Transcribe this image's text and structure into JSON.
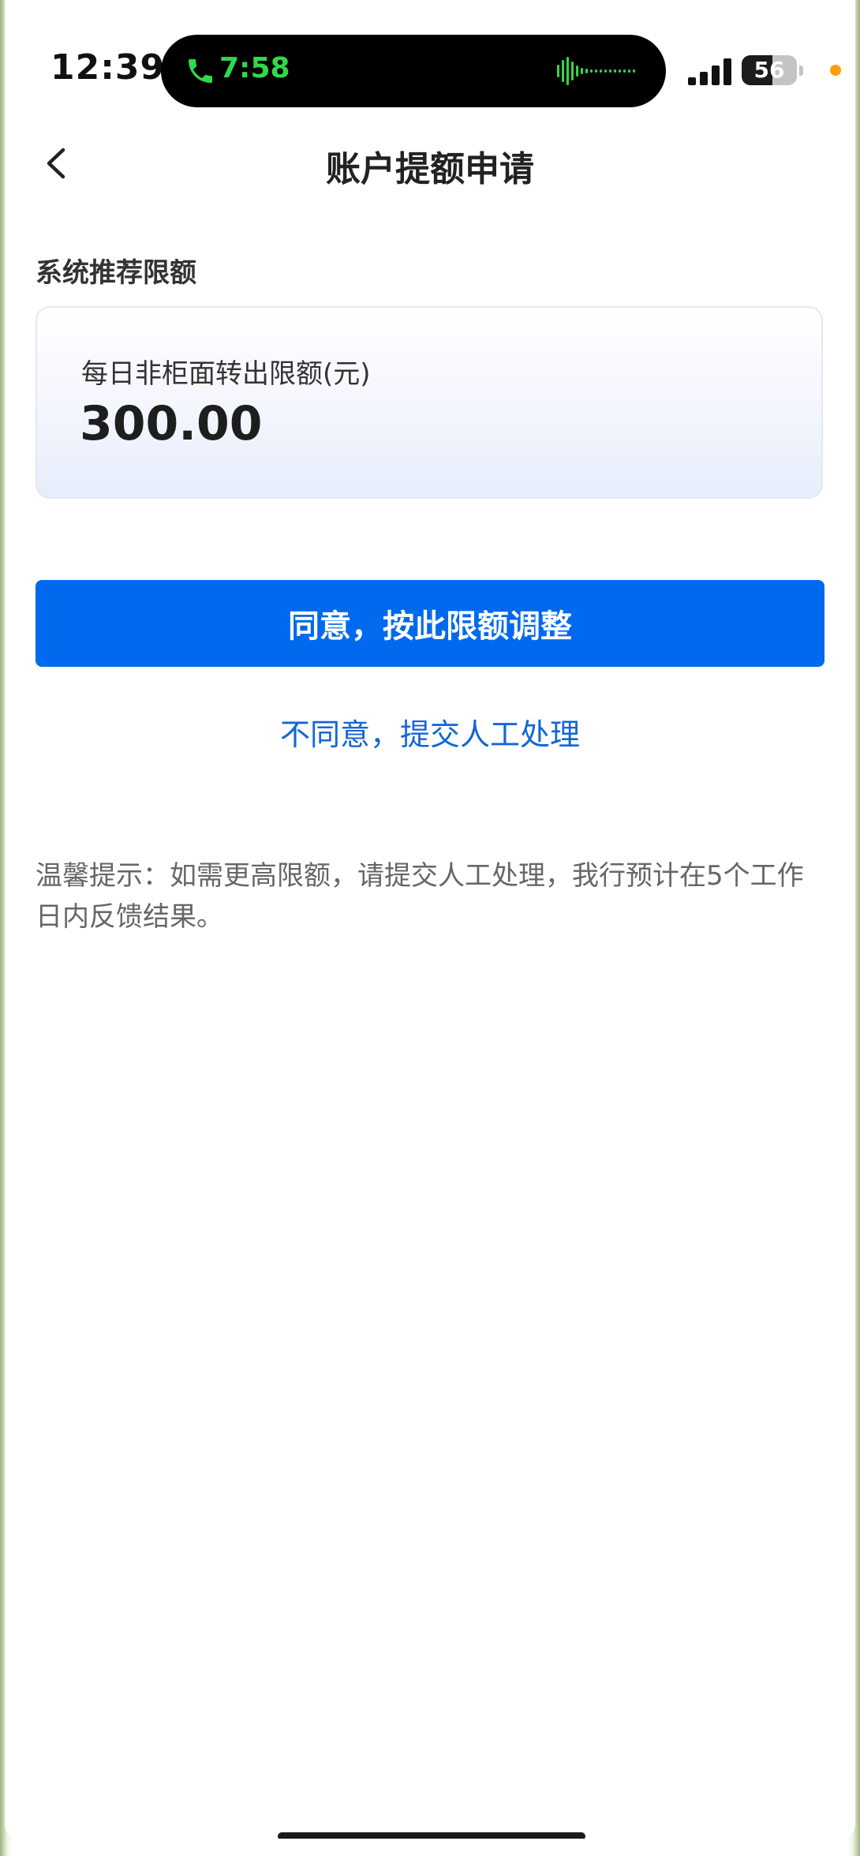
{
  "status_bar": {
    "time": "12:39",
    "call_time": "7:58",
    "battery": "56",
    "battery_level": 0.56
  },
  "nav": {
    "back_icon": "chevron-left-icon",
    "title": "账户提额申请"
  },
  "recommendation": {
    "section_title": "系统推荐限额",
    "limit_label": "每日非柜面转出限额(元)",
    "limit_value": "300.00"
  },
  "actions": {
    "agree_label": "同意，按此限额调整",
    "disagree_label": "不同意，提交人工处理"
  },
  "tip": "温馨提示：如需更高限额，请提交人工处理，我行预计在5个工作日内反馈结果。",
  "colors": {
    "primary": "#0069ee",
    "link": "#1366d6",
    "call_green": "#32d74b",
    "privacy_dot": "#ff9f0a"
  }
}
